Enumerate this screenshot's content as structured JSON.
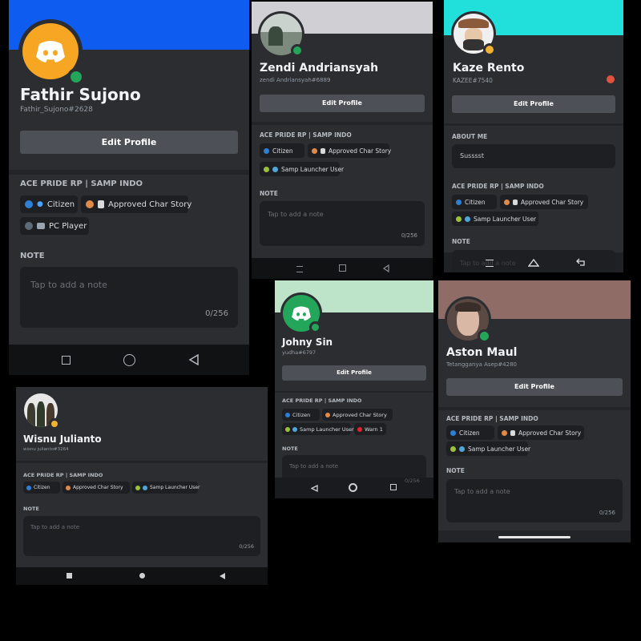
{
  "server_name": "ACE PRIDE RP | SAMP INDO",
  "edit_profile_label": "Edit Profile",
  "note_label": "NOTE",
  "note_placeholder": "Tap to add a note",
  "note_counter": "0/256",
  "colors": {
    "citizen": "#2e7fd6",
    "char_story": "#e08a49",
    "launcher": "#9bc13a",
    "pc_player": "#5d6b78",
    "warn": "#e0242f"
  },
  "roles": {
    "citizen": "Citizen",
    "char_story": "Approved Char Story",
    "launcher": "Samp Launcher User",
    "pc_player": "PC Player",
    "warn": "Warn 1"
  },
  "profiles": {
    "fathir": {
      "name": "Fathir Sujono",
      "tag": "Fathir_Sujono#2628",
      "banner": "#0f5cf0",
      "avatar_icon": "discord-logo-icon"
    },
    "zendi": {
      "name": "Zendi Andriansyah",
      "tag": "zendi Andriansyah#6889",
      "banner": "#cfcfd4"
    },
    "kaze": {
      "name": "Kaze Rento",
      "tag": "KAZEE#7540",
      "banner": "#21e0dc",
      "about_label": "ABOUT ME",
      "about_text": "Susssst"
    },
    "wisnu": {
      "name": "Wisnu Julianto",
      "tag": "wisnu julianto#3264"
    },
    "johny": {
      "name": "Johny Sin",
      "tag": "yudha#6797",
      "banner": "#bde3c8",
      "avatar_icon": "discord-logo-icon"
    },
    "aston": {
      "name": "Aston Maul",
      "tag": "Tetangganya Asep#4280",
      "banner": "#8f6c66"
    }
  }
}
